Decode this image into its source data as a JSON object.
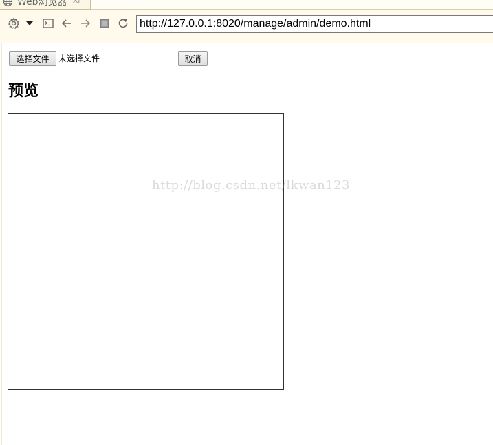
{
  "tab": {
    "title": "Web浏览器",
    "close_glyph": "⌧",
    "icon": "globe-icon"
  },
  "toolbar": {
    "url": "http://127.0.0.1:8020/manage/admin/demo.html",
    "icons": [
      "gear-icon",
      "dropdown-arrow-icon",
      "console-icon",
      "back-icon",
      "forward-icon",
      "stop-icon",
      "refresh-icon"
    ]
  },
  "page": {
    "file_button_label": "选择文件",
    "file_status": "未选择文件",
    "cancel_button_label": "取消",
    "preview_heading": "预览",
    "watermark": "http://blog.csdn.net/lkwan123"
  },
  "colors": {
    "chrome_bg": "#fffaec",
    "icon_gray": "#6b6b6b"
  }
}
